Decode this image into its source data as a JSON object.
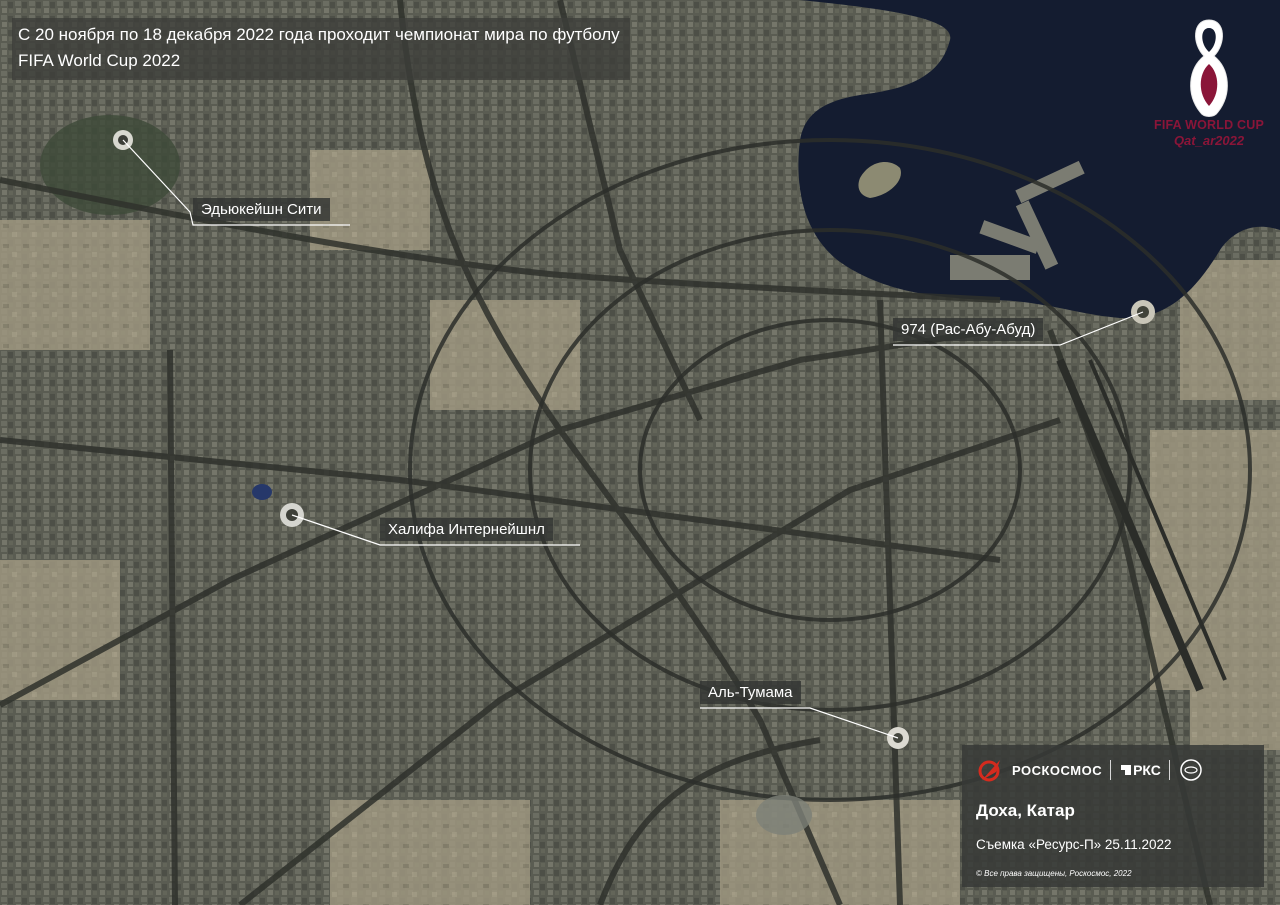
{
  "headline": {
    "line1": "С 20 ноября по 18 декабря 2022 года проходит чемпионат мира по футболу",
    "line2": "FIFA World Cup 2022"
  },
  "stadium_labels": {
    "education_city": "Эдьюкейшн Сити",
    "ras_abu_aboud": "974 (Рас-Абу-Абуд)",
    "khalifa": "Халифа Интернейшнл",
    "al_thumama": "Аль-Тумама"
  },
  "logo": {
    "line1": "FIFA WORLD CUP",
    "line2": "Qat_ar2022"
  },
  "info_panel": {
    "brand1": "РОСКОСМОС",
    "brand2": "РКС",
    "location": "Доха, Катар",
    "shot_info": "Съемка «Ресурс-П» 25.11.2022",
    "copyright": "© Все права защищены, Роскосмос, 2022"
  },
  "colors": {
    "water": "#141c30",
    "land": "#5b5d53",
    "sand": "#a39b85",
    "brand_red": "#d52b1e",
    "logo_maroon": "#8a1538"
  },
  "icons": [
    "roscosmos-rocket-icon",
    "rks-logo-icon",
    "satellite-emblem-icon",
    "world-cup-trophy-icon"
  ]
}
